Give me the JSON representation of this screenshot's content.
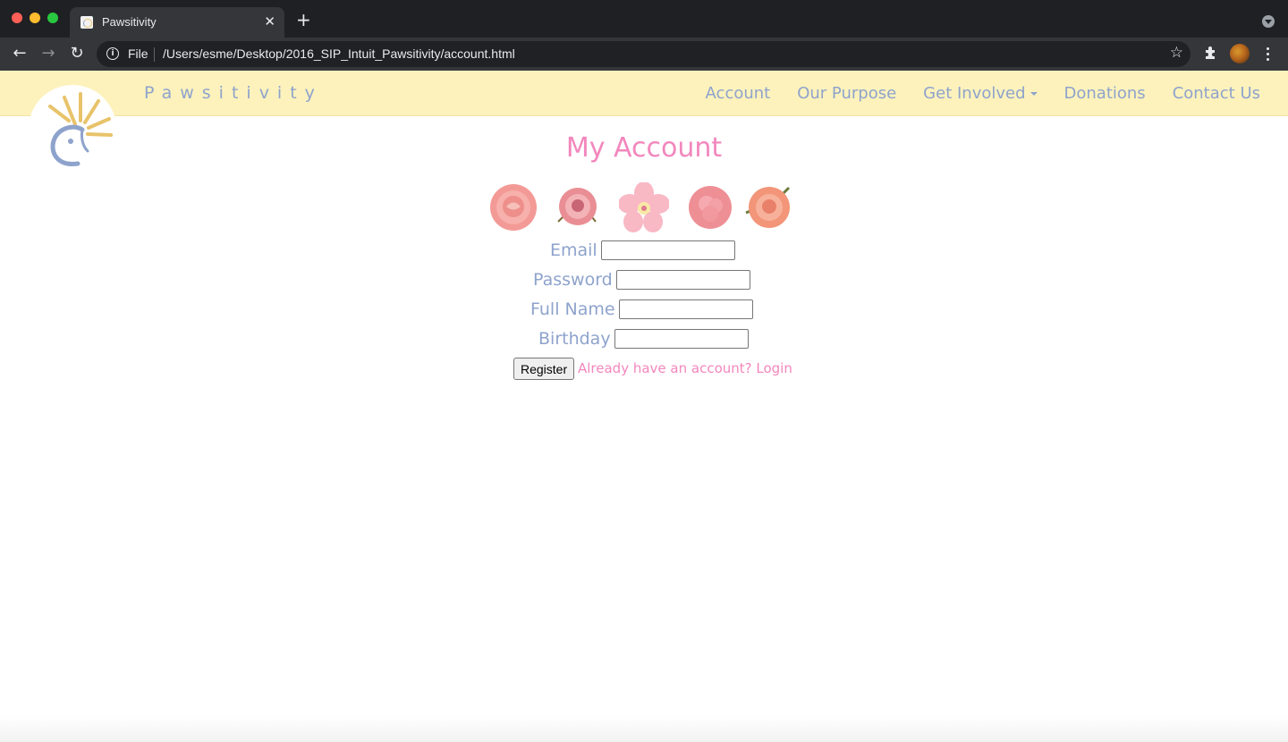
{
  "browser": {
    "tab_title": "Pawsitivity",
    "tab_close": "✕",
    "new_tab": "+",
    "url_scheme_label": "File",
    "url": "/Users/esme/Desktop/2016_SIP_Intuit_Pawsitivity/account.html",
    "icons": {
      "back": "←",
      "forward": "→",
      "reload": "↻",
      "info": "i",
      "star": "☆"
    }
  },
  "site": {
    "brand": "Pawsitivity",
    "nav": {
      "items": [
        {
          "label": "Account"
        },
        {
          "label": "Our Purpose"
        },
        {
          "label": "Get Involved",
          "dropdown": true
        },
        {
          "label": "Donations"
        },
        {
          "label": "Contact Us"
        }
      ]
    }
  },
  "page": {
    "title": "My Account",
    "form": {
      "fields": [
        {
          "label": "Email",
          "value": ""
        },
        {
          "label": "Password",
          "value": ""
        },
        {
          "label": "Full Name",
          "value": ""
        },
        {
          "label": "Birthday",
          "value": ""
        }
      ],
      "register_label": "Register",
      "login_link": "Already have an account? Login"
    }
  },
  "colors": {
    "nav_background": "#fdf2bc",
    "nav_text": "#8ea3cc",
    "accent_pink": "#f287bd",
    "logo_sun": "#e8c36a",
    "logo_blue": "#8ea3cc"
  }
}
